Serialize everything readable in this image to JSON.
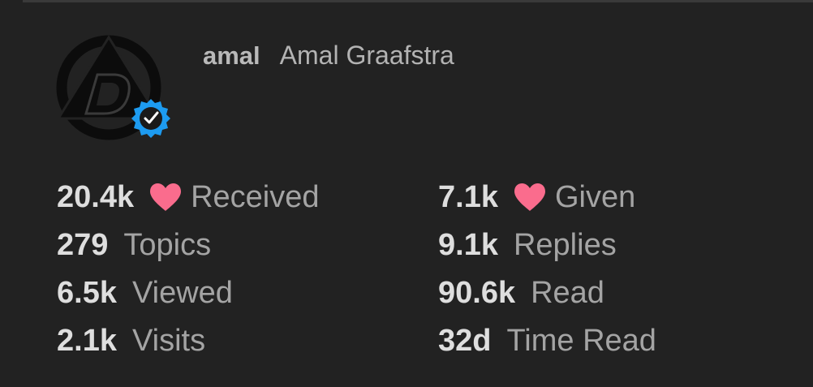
{
  "profile": {
    "username": "amal",
    "full_name": "Amal Graafstra",
    "avatar_icon": "d-triangle-logo",
    "verified_icon": "verified-badge-icon",
    "verified_color": "#1d9bf0"
  },
  "stats": {
    "received": {
      "value": "20.4k",
      "label": "Received",
      "icon": "heart-icon"
    },
    "given": {
      "value": "7.1k",
      "label": "Given",
      "icon": "heart-icon"
    },
    "topics": {
      "value": "279",
      "label": "Topics"
    },
    "replies": {
      "value": "9.1k",
      "label": "Replies"
    },
    "viewed": {
      "value": "6.5k",
      "label": "Viewed"
    },
    "read": {
      "value": "90.6k",
      "label": "Read"
    },
    "visits": {
      "value": "2.1k",
      "label": "Visits"
    },
    "time_read": {
      "value": "32d",
      "label": "Time Read"
    }
  },
  "colors": {
    "background": "#222222",
    "heart": "#fa6c8d",
    "value_text": "#dedede",
    "label_text": "#a4a4a4"
  }
}
